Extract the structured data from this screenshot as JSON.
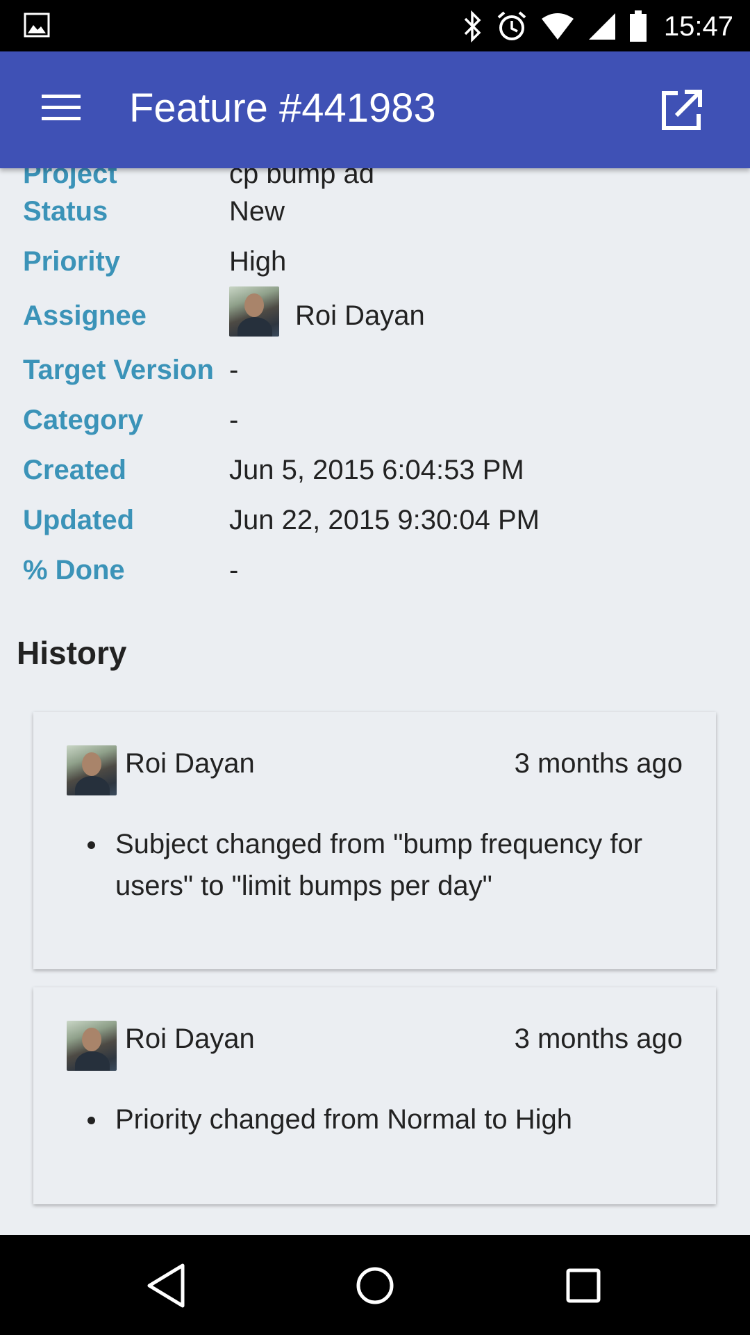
{
  "status_bar": {
    "time": "15:47",
    "icons": [
      "image-icon",
      "bluetooth-icon",
      "alarm-icon",
      "wifi-icon",
      "signal-icon",
      "battery-icon"
    ]
  },
  "app_bar": {
    "title": "Feature #441983",
    "menu_icon": "menu-icon",
    "open_icon": "open-in-new-icon"
  },
  "details": {
    "partial_label": "Project",
    "partial_value": "cp bump ad",
    "fields": [
      {
        "label": "Status",
        "value": "New"
      },
      {
        "label": "Priority",
        "value": "High"
      },
      {
        "label": "Assignee",
        "value": "Roi Dayan"
      },
      {
        "label": "Target Version",
        "value": "-"
      },
      {
        "label": "Category",
        "value": "-"
      },
      {
        "label": "Created",
        "value": "Jun 5, 2015 6:04:53 PM"
      },
      {
        "label": "Updated",
        "value": "Jun 22, 2015 9:30:04 PM"
      },
      {
        "label": "% Done",
        "value": "-"
      }
    ]
  },
  "history": {
    "title": "History",
    "entries": [
      {
        "author": "Roi Dayan",
        "time": "3 months ago",
        "changes": [
          "Subject changed from \"bump frequency for users\" to \"limit bumps per day\""
        ]
      },
      {
        "author": "Roi Dayan",
        "time": "3 months ago",
        "changes": [
          "Priority changed from Normal to High"
        ]
      }
    ]
  },
  "nav_bar": {
    "buttons": [
      "back-icon",
      "home-icon",
      "recents-icon"
    ]
  },
  "colors": {
    "app_bar": "#3f51b5",
    "label": "#3b93b8",
    "background": "#ebeef2"
  }
}
